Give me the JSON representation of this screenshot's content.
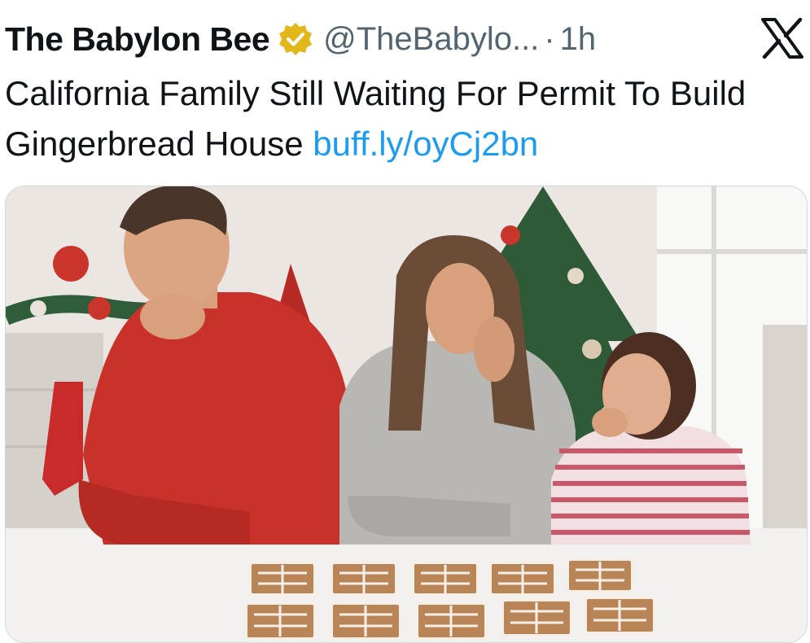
{
  "post": {
    "author_name": "The Babylon Bee",
    "verified": true,
    "handle": "@TheBabylo...",
    "separator": "·",
    "time": "1h",
    "text": "California Family Still Waiting For Permit To Build Gingerbread House ",
    "link": "buff.ly/oyCj2bn"
  },
  "icons": {
    "verified": "verified-gold-badge-icon",
    "brand": "x-logo-icon"
  },
  "colors": {
    "text": "#0f1419",
    "muted": "#536471",
    "link": "#1d9bf0",
    "badge": "#e2b719"
  }
}
